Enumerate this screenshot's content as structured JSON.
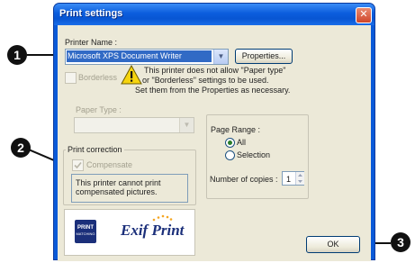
{
  "window": {
    "title": "Print settings"
  },
  "printer": {
    "label": "Printer Name :",
    "selected": "Microsoft XPS Document Writer",
    "properties_label": "Properties..."
  },
  "borderless": {
    "label": "Borderless"
  },
  "warning": {
    "line1": "This printer does not allow \"Paper type\"",
    "line2": "or \"Borderless\" settings to be used.",
    "line3": "Set them from the Properties as necessary."
  },
  "paper_type": {
    "label": "Paper Type :",
    "selected": ""
  },
  "print_correction": {
    "group_label": "Print correction",
    "compensate_label": "Compensate",
    "message_line1": "This printer cannot print",
    "message_line2": "compensated pictures."
  },
  "page_range": {
    "group_label": "Page Range :",
    "options": [
      "All",
      "Selection"
    ],
    "selected": "All"
  },
  "copies": {
    "label": "Number of copies :",
    "value": "1"
  },
  "logos": {
    "print_icon_text": "PRINT",
    "print_icon_sub": "MATCHING",
    "exif_text": "Exif Print"
  },
  "ok_label": "OK",
  "callouts": [
    "1",
    "2",
    "3"
  ],
  "colors": {
    "titlebar": "#0b5ddd",
    "face": "#ece9d8",
    "close": "#d0462a",
    "selection": "#316ac5"
  }
}
